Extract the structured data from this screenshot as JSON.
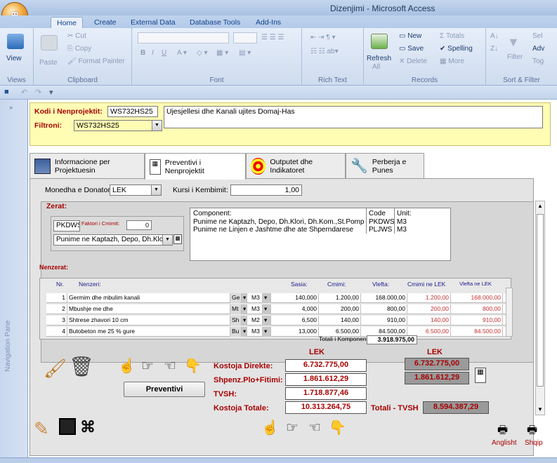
{
  "app": {
    "title": "Dizenjimi - Microsoft Access"
  },
  "ribbon_tabs": [
    "Home",
    "Create",
    "External Data",
    "Database Tools",
    "Add-Ins"
  ],
  "ribbon": {
    "views": {
      "view": "View",
      "label": "Views"
    },
    "clipboard": {
      "paste": "Paste",
      "cut": "Cut",
      "copy": "Copy",
      "format_painter": "Format Painter",
      "label": "Clipboard"
    },
    "font": {
      "label": "Font",
      "bold": "B",
      "italic": "I",
      "underline": "U"
    },
    "rich_text": {
      "label": "Rich Text"
    },
    "records": {
      "refresh": "Refresh",
      "refresh_all": "All",
      "new": "New",
      "save": "Save",
      "delete": "Delete",
      "totals": "Totals",
      "spelling": "Spelling",
      "more": "More",
      "label": "Records"
    },
    "sort_filter": {
      "filter": "Filter",
      "selection": "Sel",
      "advanced": "Adv",
      "toggle": "Tog",
      "label": "Sort & Filter"
    }
  },
  "nav_pane": {
    "label": "Navigation Pane"
  },
  "header": {
    "kodi_label": "Kodi i Nenprojektit:",
    "kodi_value": "WS732HS25",
    "description": "Ujesjellesi dhe Kanali ujites Domaj-Has",
    "filtroni_label": "Filtroni:",
    "filtroni_value": "WS732HS25"
  },
  "form_tabs": [
    "Informacione per Projektuesin",
    "Preventivi i Nenprojektit",
    "Outputet dhe Indikatoret",
    "Perberja e Punes"
  ],
  "currency": {
    "label": "Monedha e Donatorit:",
    "value": "LEK",
    "rate_label": "Kursi i Kembimit:",
    "rate_value": "1,00"
  },
  "zerat": {
    "label": "Zerat:",
    "code_value": "PKDWS",
    "factor_label": "Faktori i Cmimit:",
    "factor_value": "0",
    "combo_value": "Punime ne Kaptazh, Depo, Dh.Klori,"
  },
  "component_table": {
    "headers": [
      "Component:",
      "Code",
      "Unit:"
    ],
    "rows": [
      [
        "Punime ne Kaptazh, Depo, Dh.Klori, Dh.Kom.,St.Pomp",
        "PKDWS",
        "M3"
      ],
      [
        "Punime ne Linjen e Jashtme dhe ate Shperndarese",
        "PLJWS",
        "M3"
      ]
    ]
  },
  "nenzerat": {
    "label": "Nenzerat:",
    "headers": [
      "Nr.",
      "Nenzeri:",
      "Sasia:",
      "Cmimi:",
      "Vlefta:",
      "Cmimi ne LEK",
      "Vlefta ne LEK"
    ],
    "rows": [
      [
        "1",
        "Germim dhe mbulim kanali",
        "Ge",
        "M3",
        "140,000",
        "1.200,00",
        "168.000,00",
        "1.200,00",
        "168.000,00"
      ],
      [
        "2",
        "Mbushje me dhe",
        "Mt",
        "M3",
        "4,000",
        "200,00",
        "800,00",
        "200,00",
        "800,00"
      ],
      [
        "3",
        "Shtrese zhavori 10 cm",
        "Sh",
        "M2",
        "6,500",
        "140,00",
        "910,00",
        "140,00",
        "910,00"
      ],
      [
        "4",
        "Butobeton me 25 % gure",
        "Bu",
        "M3",
        "13,000",
        "6.500,00",
        "84.500,00",
        "6.500,00",
        "84.500,00"
      ]
    ],
    "total_label": "Totali i Komponentes:",
    "total_value": "3.918.975,00"
  },
  "summary": {
    "currency_a": "LEK",
    "currency_b": "LEK",
    "direct_label": "Kostoja Direkte:",
    "direct_value": "6.732.775,00",
    "direct_value_lek": "6.732.775,00",
    "overhead_label": "Shpenz.Plo+Fitimi:",
    "overhead_value": "1.861.612,29",
    "overhead_value_lek": "1.861.612,29",
    "tvsh_label": "TVSH:",
    "tvsh_value": "1.718.877,46",
    "total_label": "Kostoja Totale:",
    "total_value": "10.313.264,75",
    "total_tvsh_label": "Totali - TVSH",
    "total_tvsh_value": "8.594.387,29"
  },
  "buttons": {
    "preventivi": "Preventivi",
    "anglisht": "Anglisht",
    "shqip": "Shqip"
  }
}
